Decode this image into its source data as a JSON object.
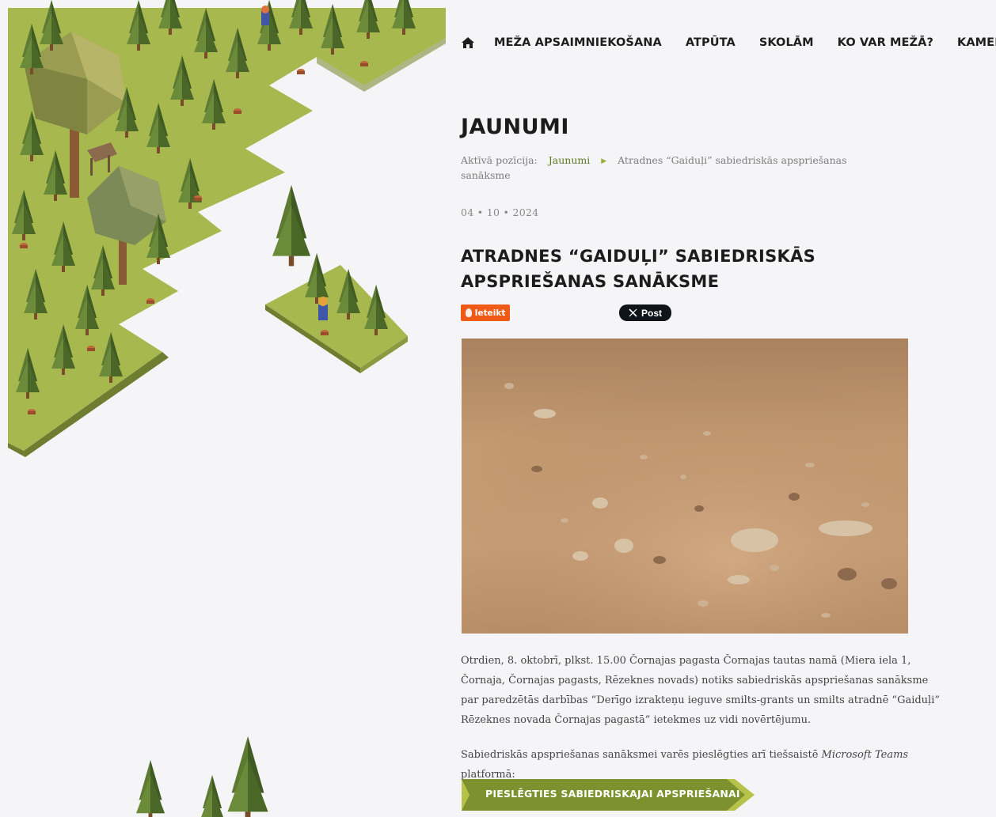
{
  "nav": {
    "items": [
      "MEŽA APSAIMNIEKOŠANA",
      "ATPŪTA",
      "SKOLĀM",
      "KO VAR MEŽĀ?",
      "KAMERAS"
    ]
  },
  "section_title": "JAUNUMI",
  "breadcrumb": {
    "label": "Aktīvā pozīcija:",
    "link": "Jaunumi",
    "current": "Atradnes “Gaiduļi” sabiedriskās apspriešanas sanāksme"
  },
  "article": {
    "date": "04 • 10 • 2024",
    "title": "ATRADNES “GAIDUĻI” SABIEDRISKĀS APSPRIEŠANAS SANĀKSME",
    "share_label": "Ieteikt",
    "post_label": "Post",
    "paragraph1": "Otrdien, 8. oktobrī, plkst. 15.00 Čornajas pagasta Čornajas tautas namā (Miera iela 1, Čornaja, Čornajas pagasts, Rēzeknes novads) notiks sabiedriskās apspriešanas sanāksme par paredzētās darbības “Derīgo izrakteņu ieguve smilts-grants un smilts atradnē “Gaiduļi” Rēzeknes novada Čornajas pagastā” ietekmes uz vidi novērtējumu.",
    "paragraph2_start": "Sabiedriskās apspriešanas sanāksmei varēs pieslēgties arī tiešsaistē ",
    "paragraph2_em": "Microsoft Teams",
    "paragraph2_end": " platformā:",
    "cta_label": "PIESLĒGTIES SABIEDRISKAJAI APSPRIEŠANAI"
  },
  "colors": {
    "accent_green": "#7d922e",
    "share_orange": "#ef5a17",
    "grass": "#a7b84f"
  },
  "icons": [
    "home-icon",
    "flame-icon",
    "x-logo-icon",
    "chevron-right-icon"
  ]
}
